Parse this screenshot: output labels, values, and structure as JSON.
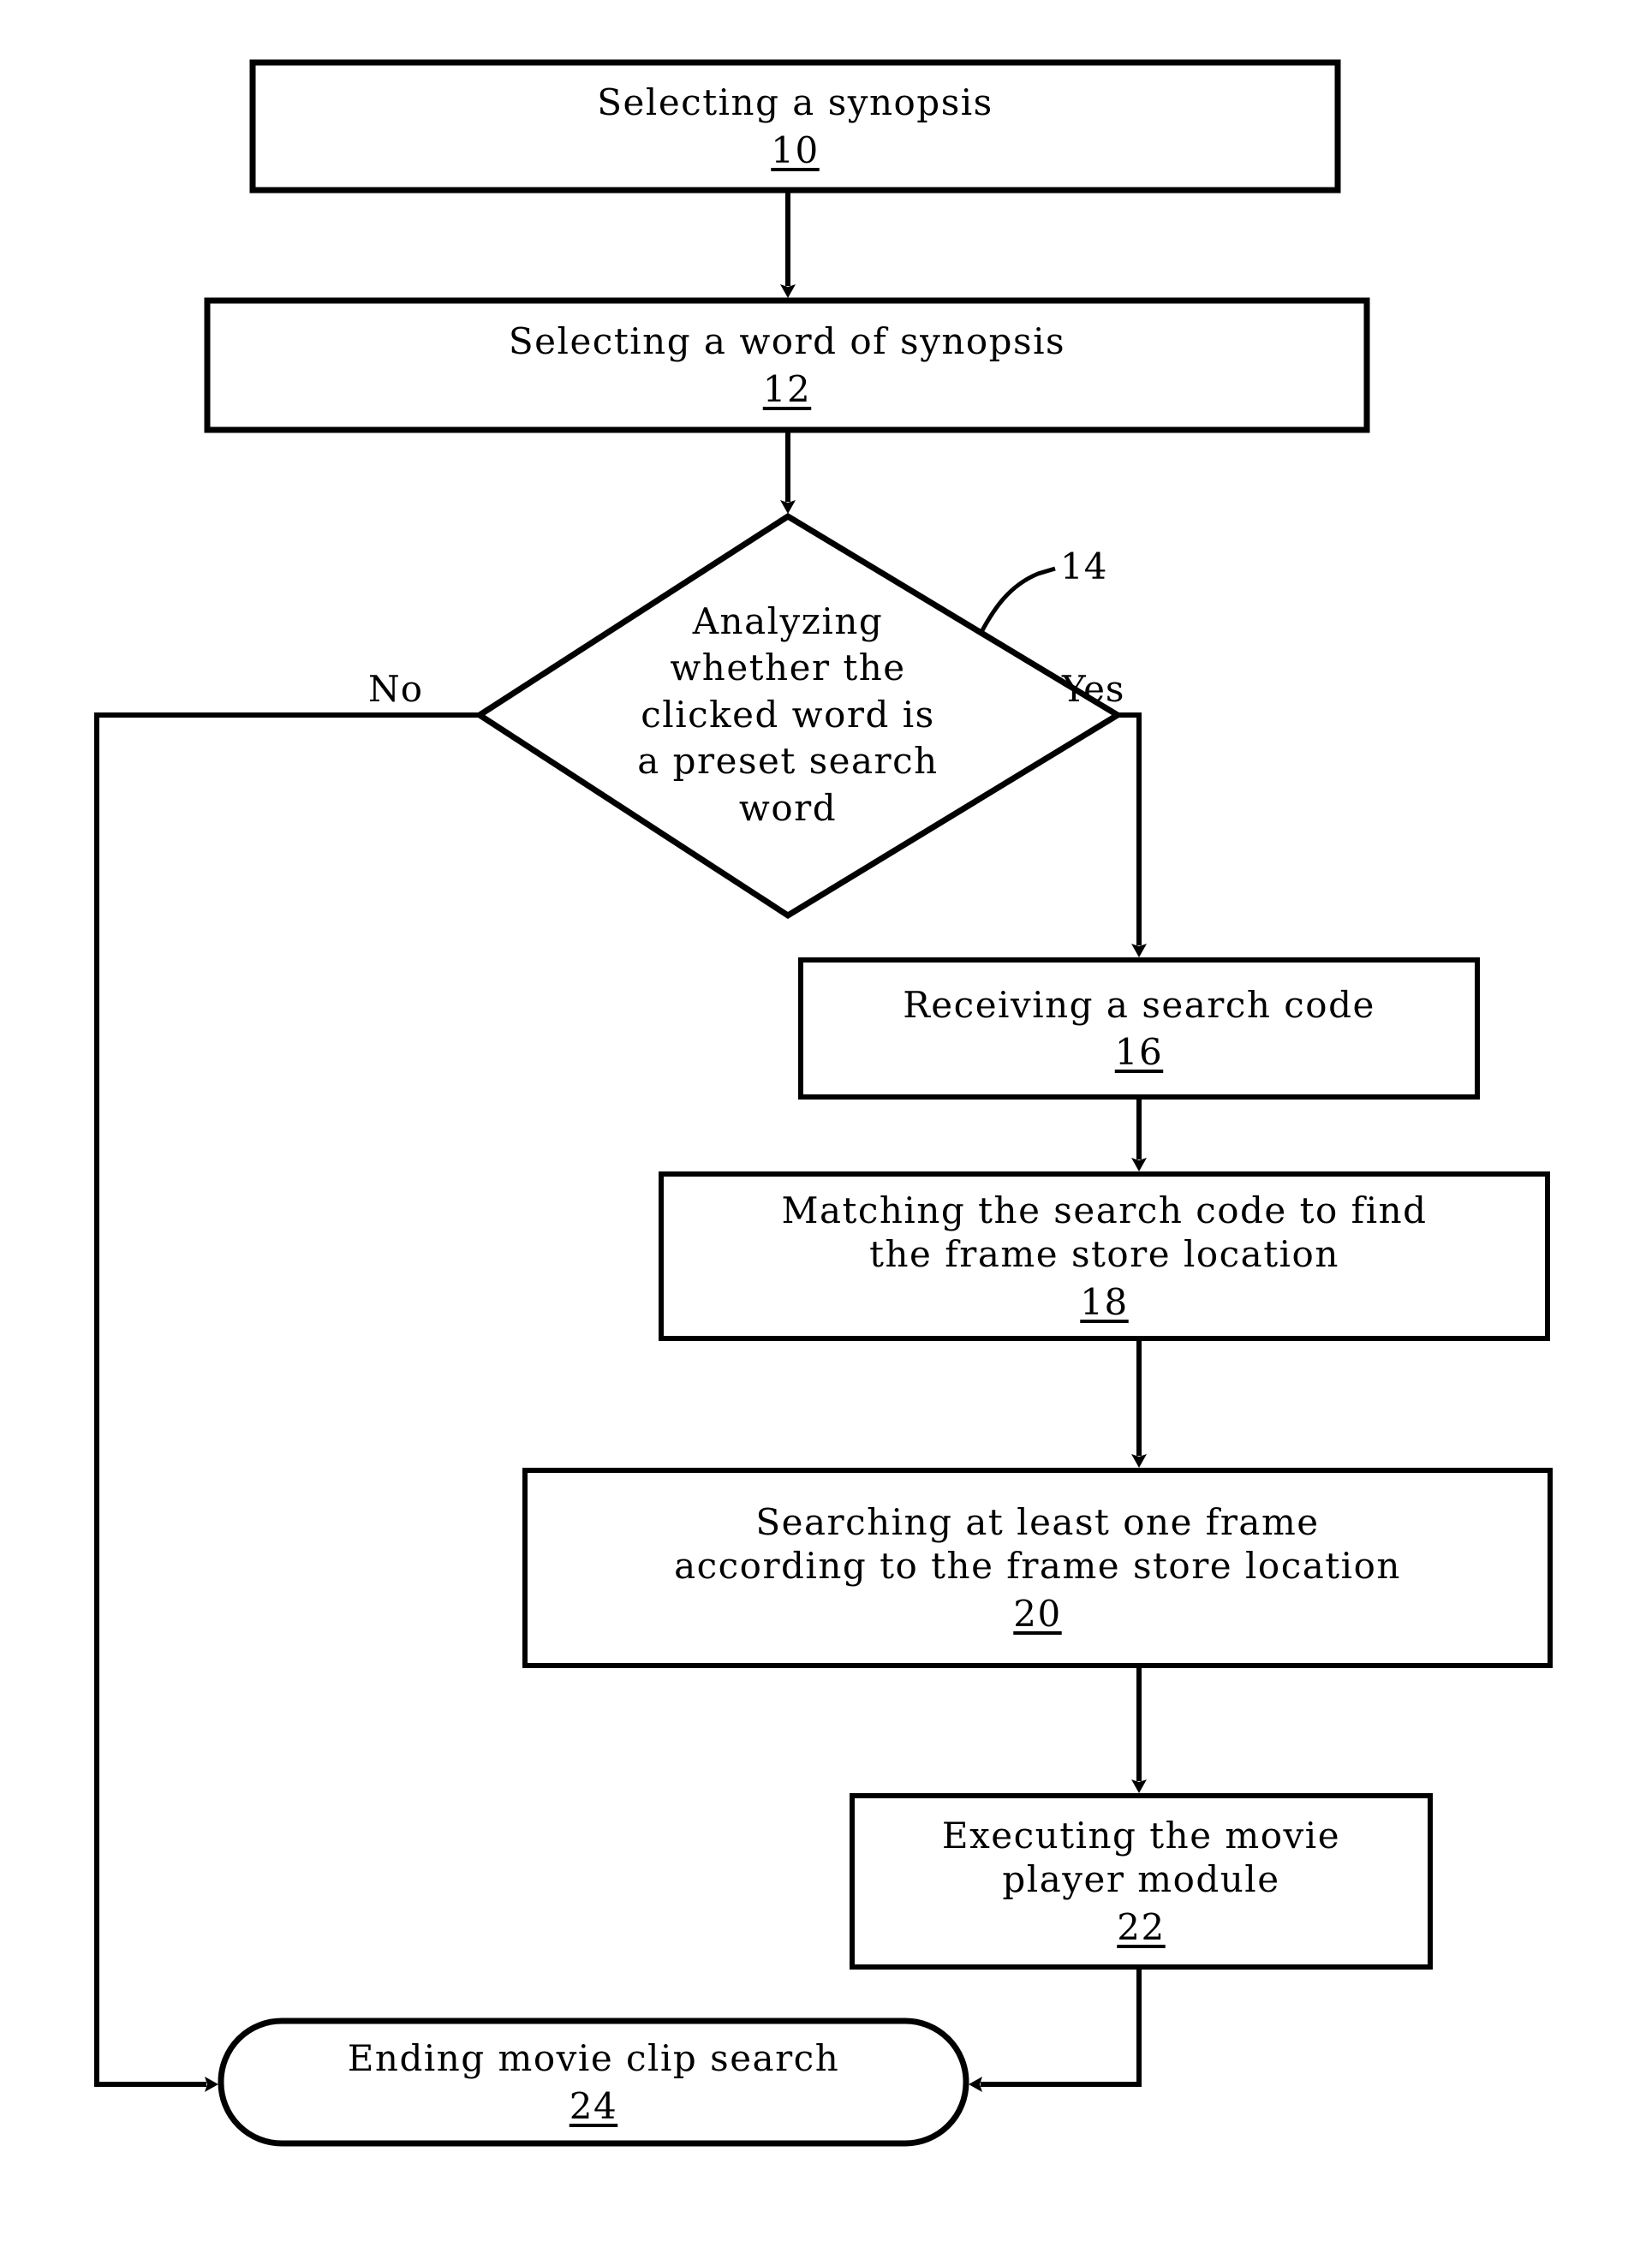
{
  "figure": {
    "type": "flowchart",
    "title": "Movie clip search method flowchart",
    "background_color": "#ffffff",
    "line_color": "#000000"
  },
  "nodes": [
    {
      "id": "n10",
      "shape": "process",
      "label": "Selecting a synopsis",
      "ref": "10"
    },
    {
      "id": "n12",
      "shape": "process",
      "label": "Selecting a word of synopsis",
      "ref": "12"
    },
    {
      "id": "n14",
      "shape": "decision",
      "label": "Analyzing\nwhether the\nclicked word is\na preset search\nword",
      "ref": "14"
    },
    {
      "id": "n16",
      "shape": "process",
      "label": "Receiving a search code",
      "ref": "16"
    },
    {
      "id": "n18",
      "shape": "process",
      "label": "Matching the search code to find\nthe frame store location",
      "ref": "18"
    },
    {
      "id": "n20",
      "shape": "process",
      "label": "Searching at least one frame\naccording to the frame store location",
      "ref": "20"
    },
    {
      "id": "n22",
      "shape": "process",
      "label": "Executing the movie\nplayer module",
      "ref": "22"
    },
    {
      "id": "n24",
      "shape": "terminator",
      "label": "Ending movie clip search",
      "ref": "24"
    }
  ],
  "edge_labels": {
    "no": "No",
    "yes": "Yes"
  },
  "callouts": {
    "decision_ref": "14"
  }
}
